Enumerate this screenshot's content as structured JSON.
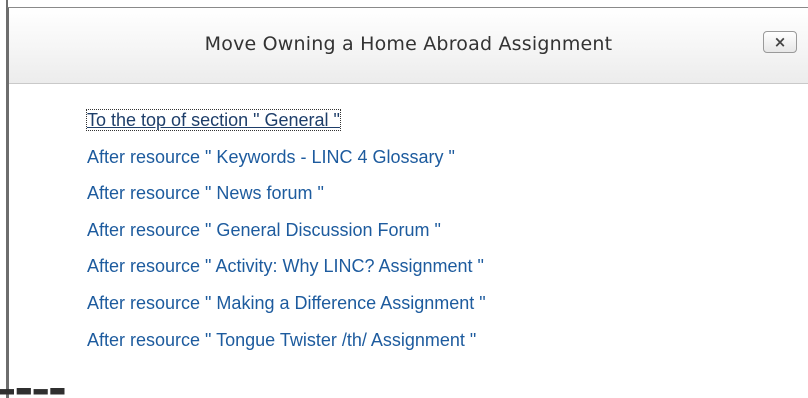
{
  "dialog": {
    "title": "Move Owning a Home Abroad Assignment",
    "close_label": "×"
  },
  "move_targets": [
    "To the top of section \" General \"",
    "After resource \" Keywords - LINC 4 Glossary \"",
    "After resource \" News forum \"",
    "After resource \" General Discussion Forum \"",
    "After resource \" Activity: Why LINC? Assignment \"",
    "After resource \" Making a Difference Assignment \"",
    "After resource \" Tongue Twister /th/ Assignment \""
  ]
}
